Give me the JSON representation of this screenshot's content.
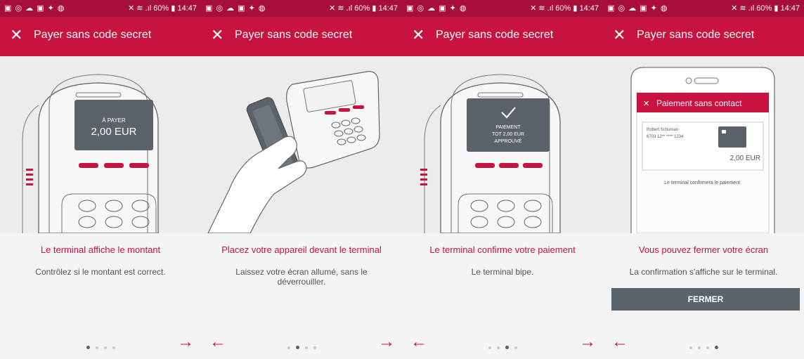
{
  "status": {
    "left_icons": "▣ ◎ ☁ ▣ ✦ ◍",
    "right": "✕ ≋ .ıl 60% ▮ 14:47"
  },
  "panels": [
    {
      "title": "Payer sans code secret",
      "screen_lines": [
        "À PAYER",
        "2,00 EUR"
      ],
      "step_title": "Le terminal affiche le montant",
      "step_desc": "Contrôlez si le montant est correct.",
      "active_dot": 0
    },
    {
      "title": "Payer sans code secret",
      "step_title": "Placez votre appareil devant le terminal",
      "step_desc": "Laissez votre écran allumé, sans le déverrouiller.",
      "active_dot": 1
    },
    {
      "title": "Payer sans code secret",
      "screen_lines": [
        "PAIEMENT",
        "TOT 2,00 EUR",
        "APPROUVÉ"
      ],
      "step_title": "Le terminal confirme votre paiement",
      "step_desc": "Le terminal bipe.",
      "active_dot": 2
    },
    {
      "title": "Payer sans code secret",
      "step_title": "Vous pouvez fermer votre écran",
      "step_desc": "La confirmation s'affiche sur le terminal.",
      "button_label": "FERMER",
      "phone": {
        "header": "Paiement sans contact",
        "card_name": "Robert Schuman",
        "card_number": "6703 12** **** 1234",
        "amount": "2,00 EUR",
        "note": "Le terminal confirmera le paiement."
      },
      "active_dot": 3
    }
  ],
  "colors": {
    "brand": "#c8123f",
    "status_bar": "#a70e3c",
    "button": "#59636b"
  }
}
